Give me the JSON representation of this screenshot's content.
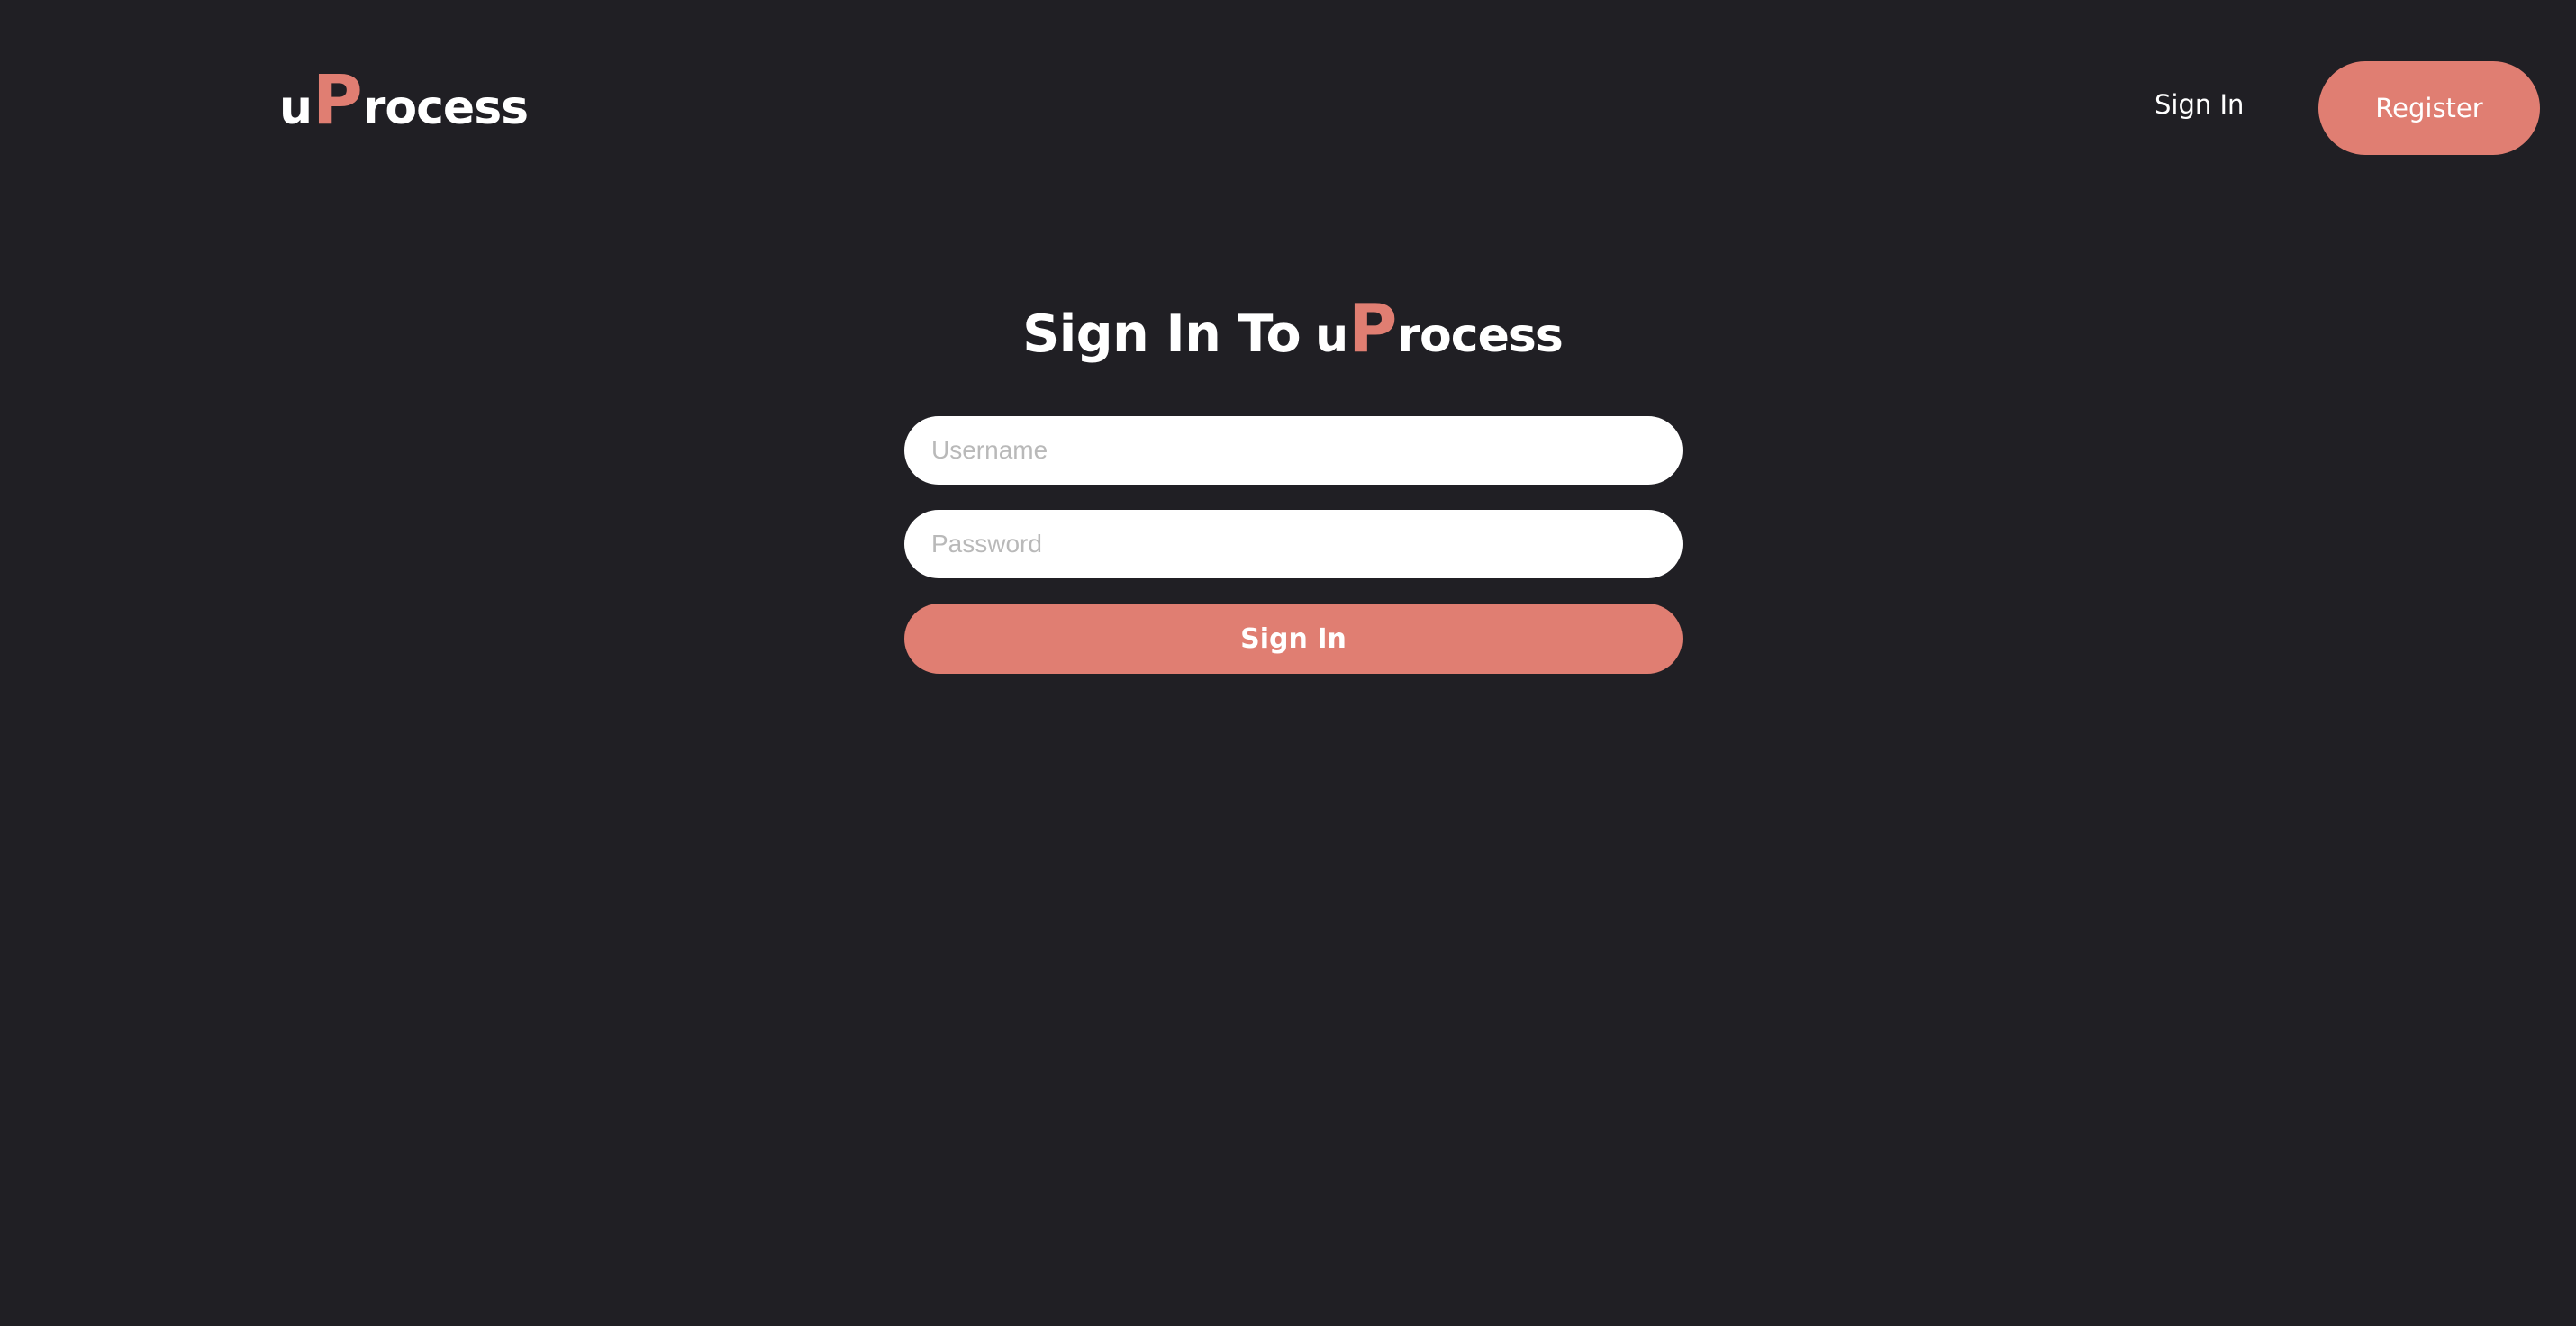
{
  "brand": {
    "prefix": "u",
    "highlight": "P",
    "suffix": "rocess"
  },
  "nav": {
    "signin_label": "Sign In",
    "register_label": "Register"
  },
  "heading": {
    "text": "Sign In To",
    "brand_prefix": "u",
    "brand_highlight": "P",
    "brand_suffix": "rocess"
  },
  "form": {
    "username_placeholder": "Username",
    "username_value": "",
    "password_placeholder": "Password",
    "password_value": "",
    "submit_label": "Sign In"
  },
  "colors": {
    "background": "#201f24",
    "accent": "#e07e72",
    "text": "#ffffff",
    "input_background": "#ffffff",
    "placeholder": "#b9b9b9"
  }
}
